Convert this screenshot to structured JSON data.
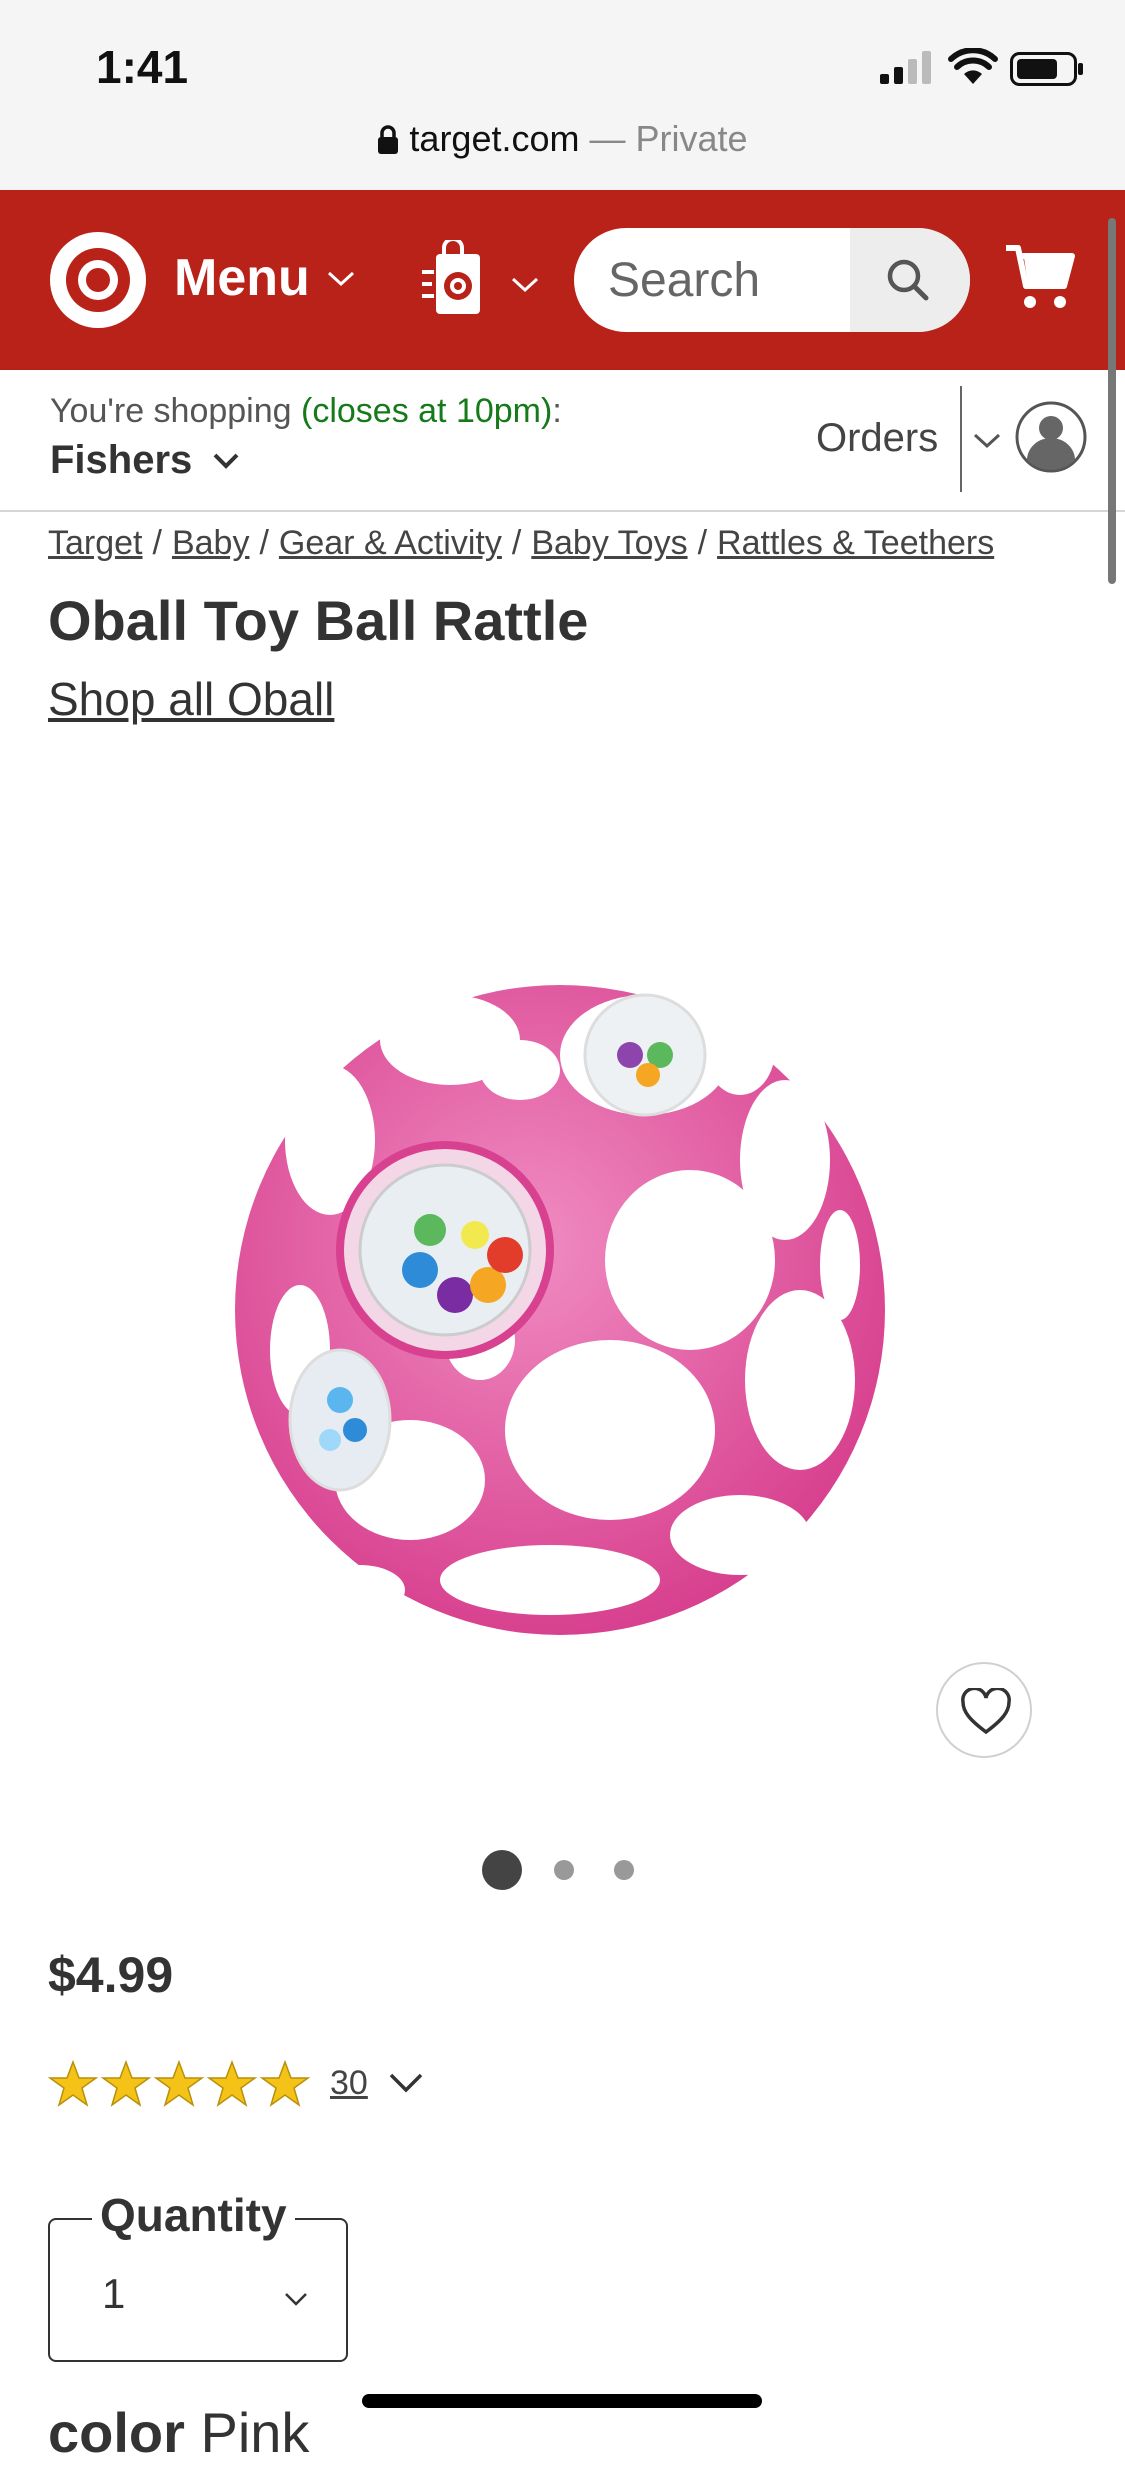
{
  "status_bar": {
    "time": "1:41"
  },
  "address_bar": {
    "domain": "target.com",
    "separator": " — ",
    "mode": "Private"
  },
  "header": {
    "menu_label": "Menu",
    "search_placeholder": "Search",
    "brand_color": "#b82219"
  },
  "store_bar": {
    "shopping_prefix": "You're shopping ",
    "closing_info": "(closes at 10pm)",
    "shopping_suffix": ":",
    "store_name": "Fishers",
    "orders_label": "Orders"
  },
  "breadcrumbs": [
    "Target",
    "Baby",
    "Gear & Activity",
    "Baby Toys",
    "Rattles & Teethers"
  ],
  "product": {
    "title": "Oball Toy Ball Rattle",
    "shop_all_link": "Shop all Oball",
    "image_color": "#e8559f",
    "price": "$4.99",
    "rating_stars": 5,
    "review_count": "30",
    "carousel": {
      "total": 3,
      "active": 1
    },
    "quantity_label": "Quantity",
    "quantity_value": "1",
    "color_label": "color",
    "color_value": "Pink"
  }
}
